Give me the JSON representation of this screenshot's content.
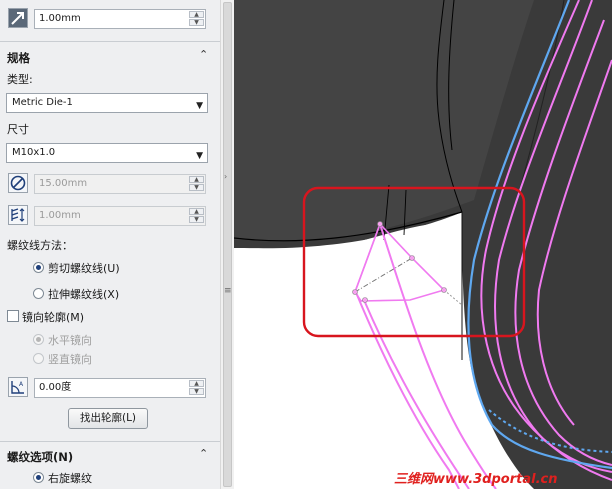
{
  "colors": {
    "panel_bg": "#eeeff1",
    "model_dark": "#3b3b3b",
    "highlight_box": "#d8151e",
    "profile_line": "#f07af0",
    "edge_blue": "#5fa8f0",
    "watermark": "#e0201e"
  },
  "top": {
    "icon": "arrow-diagonal-icon",
    "offset_value": "1.00mm"
  },
  "spec": {
    "title": "规格",
    "type_label": "类型:",
    "type_value": "Metric Die-1",
    "size_label": "尺寸",
    "size_value": "M10x1.0",
    "diameter_value": "15.00mm",
    "pitch_value": "1.00mm",
    "method_label": "螺纹线方法：",
    "method_options": [
      "剪切螺纹线(U)",
      "拉伸螺纹线(X)"
    ],
    "method_selected": 0,
    "mirror_label": "镜向轮廓(M)",
    "mirror_options": [
      "水平镜向",
      "竖直镜向"
    ],
    "angle_value": "0.00度",
    "find_profile_button": "找出轮廓(L)"
  },
  "thread_options": {
    "title": "螺纹选项(N)",
    "option": "右旋螺纹"
  },
  "watermark": "三维网www.3dportal.cn"
}
